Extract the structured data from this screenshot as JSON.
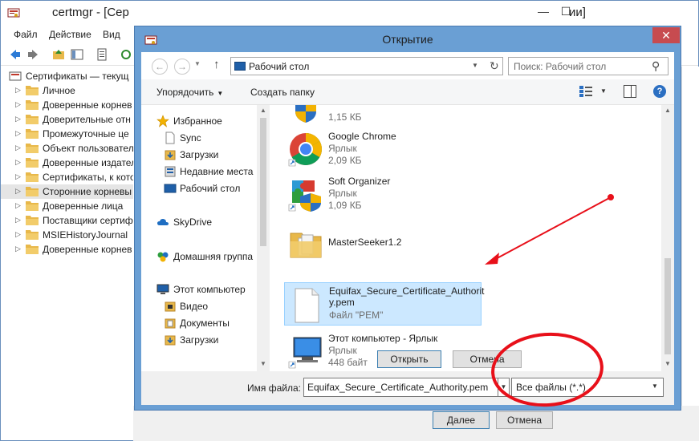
{
  "bg_window": {
    "title": "certmgr - [Сер",
    "title_tail": "ии]",
    "minimize_glyph": "—",
    "maximize_glyph": "☐",
    "menu": [
      "Файл",
      "Действие",
      "Вид"
    ],
    "tree_root": "Сертификаты — текущ",
    "tree_items": [
      "Личное",
      "Доверенные корнев",
      "Доверительные отн",
      "Промежуточные це",
      "Объект пользовател",
      "Доверенные издател",
      "Сертификаты, к кото",
      "Сторонние корневы",
      "Доверенные лица",
      "Поставщики сертиф",
      "MSIEHistoryJournal",
      "Доверенные корнев"
    ],
    "next_button": "Далее",
    "cancel_button": "Отмена"
  },
  "dialog": {
    "title": "Открытие",
    "close_glyph": "✕",
    "address": "Рабочий стол",
    "search_placeholder": "Поиск: Рабочий стол",
    "organize": "Упорядочить",
    "new_folder": "Создать папку",
    "nav": {
      "favorites": "Избранное",
      "sync": "Sync",
      "downloads": "Загрузки",
      "recent": "Недавние места",
      "desktop": "Рабочий стол",
      "skydrive": "SkyDrive",
      "homegroup": "Домашняя группа",
      "computer": "Этот компьютер",
      "video": "Видео",
      "documents": "Документы",
      "downloads2": "Загрузки"
    },
    "files": {
      "partial_size": "1,15 КБ",
      "chrome_name": "Google Chrome",
      "chrome_type": "Ярлык",
      "chrome_size": "2,09 КБ",
      "softorg_name": "Soft Organizer",
      "softorg_type": "Ярлык",
      "softorg_size": "1,09 КБ",
      "folder_name": "MasterSeeker1.2",
      "pem_name_line1": "Equifax_Secure_Certificate_Authorit",
      "pem_name_line2": "y.pem",
      "pem_type": "Файл \"PEM\"",
      "computer_name": "Этот компьютер - Ярлык",
      "computer_type": "Ярлык",
      "computer_size": "448 байт"
    },
    "filename_label": "Имя файла:",
    "filename_value": "Equifax_Secure_Certificate_Authority.pem",
    "filetype": "Все файлы (*.*)",
    "open_button": "Открыть",
    "cancel_button": "Отмена"
  },
  "colors": {
    "dialog_frame": "#6a9fd4",
    "close_red": "#c74b50",
    "selection": "#cce8ff",
    "annotation_red": "#e8101a"
  }
}
